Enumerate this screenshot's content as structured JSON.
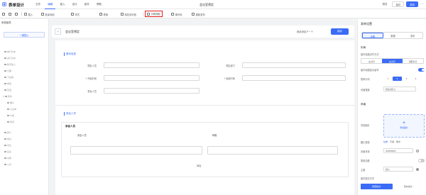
{
  "app": {
    "title": "表单设计",
    "menu": [
      "文件",
      "编辑",
      "插入",
      "设计",
      "组件",
      "帮助"
    ],
    "active_menu_index": 1,
    "document_title": "会议室预定",
    "top_actions": {
      "preview": "预览",
      "save": "保存",
      "publish": "发布"
    }
  },
  "toolbar": {
    "items": [
      "插入",
      "批量添加",
      "样式",
      "表单",
      "绑定到字段",
      "字段映射",
      "切换视图",
      "源代码",
      "重新发布"
    ],
    "highlighted_index": 6
  },
  "sidebar": {
    "title": "系统组件",
    "group_label": "一键插入",
    "items": [
      "单行文本",
      "多行文本",
      "数字输入",
      "日期",
      "下拉框",
      "单选",
      "复选",
      "附件",
      "图片",
      "子表单",
      "分组",
      "成员",
      "部门",
      "地址",
      "定位",
      "签名",
      "关联",
      "公式"
    ]
  },
  "canvas": {
    "title": "会议室预定",
    "link": "继续添加下一个",
    "save": "保存",
    "section1": "基本信息",
    "fields": [
      {
        "label": "预定人员",
        "value": ""
      },
      {
        "label": "预定部门",
        "value": ""
      },
      {
        "label": "* 开始时间",
        "value": ""
      },
      {
        "label": "* 结束时间",
        "value": ""
      },
      {
        "label": "参会人员",
        "value": ""
      }
    ],
    "section2": "参会人员",
    "subtable": {
      "title": "参会人员",
      "columns": [
        "参会人员",
        "邮箱"
      ],
      "add_label": "添加"
    }
  },
  "right_panel": {
    "title": "表单设置",
    "tabs": [
      "设置",
      "数据",
      "发布"
    ],
    "active_tab": 0,
    "layout_section": "布局",
    "label_align_label": "组件标题对齐方式",
    "label_align_options": [
      "左对齐",
      "右对齐",
      "顶部对齐"
    ],
    "label_align_active": 1,
    "show_label_label": "组件标题显示星号",
    "show_label_on": true,
    "columns_label": "表单分列",
    "columns_options": [
      "1",
      "2",
      "3",
      "4"
    ],
    "columns_active": 1,
    "width_label": "页面宽度",
    "width_value": "较宽(默认)",
    "style_section": "风格",
    "bg_image_label": "背景图片",
    "upload_label": "添加图片",
    "bg_type_label": "图片类型",
    "bg_type_options": [
      "拉伸",
      "平铺",
      "居中"
    ],
    "bg_color_label": "页面背景",
    "bg_color_value": "#EBEBEB",
    "form_shadow_label": "表单边框",
    "form_shadow_on": false,
    "theme_label": "主题",
    "theme_value": "默认",
    "submit_label": "组件提交方式",
    "submit_options": [
      "按钮提交",
      "回车提交"
    ],
    "submit_active": 0,
    "accent_color": "#3b6cf6"
  }
}
